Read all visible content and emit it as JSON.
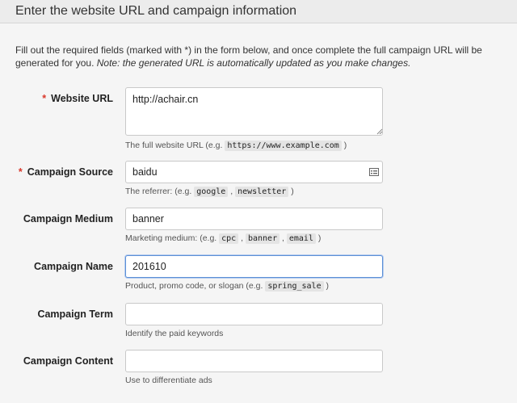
{
  "header": {
    "title": "Enter the website URL and campaign information"
  },
  "intro": {
    "text": "Fill out the required fields (marked with *) in the form below, and once complete the full campaign URL will be generated for you.",
    "note": "Note: the generated URL is automatically updated as you make changes."
  },
  "form": {
    "required_mark": "*",
    "website_url": {
      "label": "Website URL",
      "value": "http://achair.cn",
      "help_prefix": "The full website URL (e.g.",
      "help_codes": [
        "https://www.example.com"
      ],
      "help_suffix": ")"
    },
    "campaign_source": {
      "label": "Campaign Source",
      "value": "baidu",
      "icon": "list-card-icon",
      "help_prefix": "The referrer: (e.g.",
      "help_codes": [
        "google",
        "newsletter"
      ],
      "help_suffix": ")"
    },
    "campaign_medium": {
      "label": "Campaign Medium",
      "value": "banner",
      "help_prefix": "Marketing medium: (e.g.",
      "help_codes": [
        "cpc",
        "banner",
        "email"
      ],
      "help_suffix": ")"
    },
    "campaign_name": {
      "label": "Campaign Name",
      "value": "201610",
      "help_prefix": "Product, promo code, or slogan (e.g.",
      "help_codes": [
        "spring_sale"
      ],
      "help_suffix": ")"
    },
    "campaign_term": {
      "label": "Campaign Term",
      "value": "",
      "help": "Identify the paid keywords"
    },
    "campaign_content": {
      "label": "Campaign Content",
      "value": "",
      "help": "Use to differentiate ads"
    }
  },
  "colors": {
    "required": "#d9372a",
    "focus_border": "#5b8fd6"
  }
}
